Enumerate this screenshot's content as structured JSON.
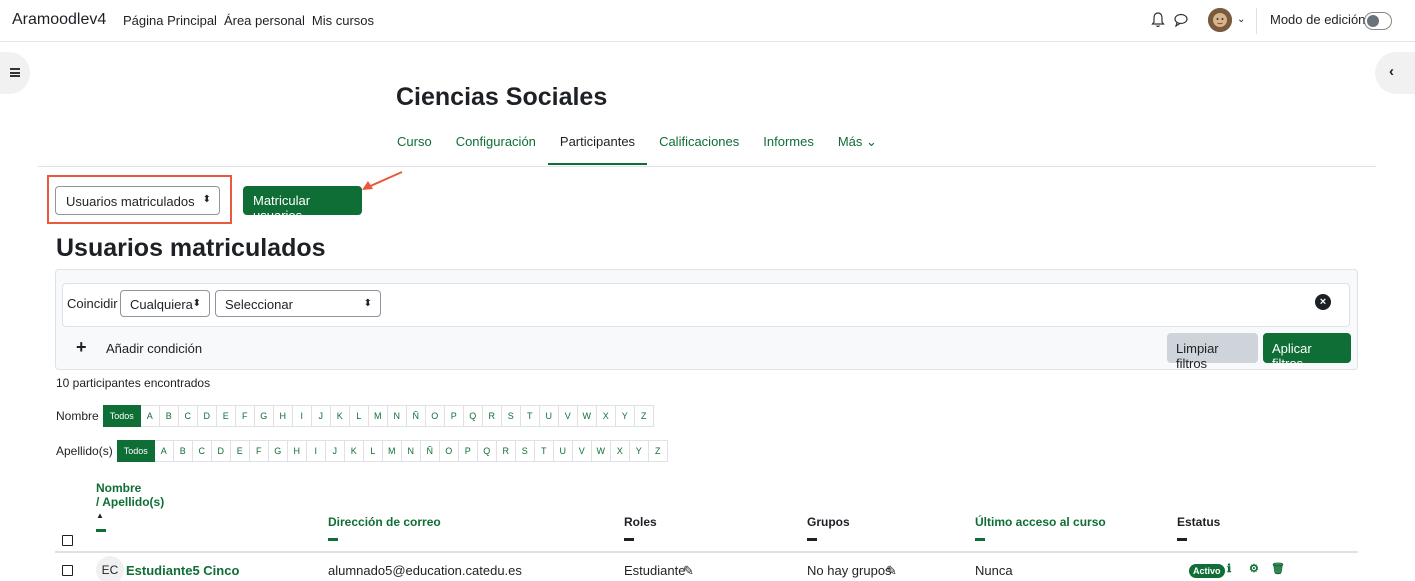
{
  "navbar": {
    "brand": "Aramoodlev4",
    "links": [
      "Página Principal",
      "Área personal",
      "Mis cursos"
    ],
    "edit_mode_label": "Modo de edición"
  },
  "course": {
    "title": "Ciencias Sociales",
    "tabs": [
      {
        "label": "Curso",
        "active": false
      },
      {
        "label": "Configuración",
        "active": false
      },
      {
        "label": "Participantes",
        "active": true
      },
      {
        "label": "Calificaciones",
        "active": false
      },
      {
        "label": "Informes",
        "active": false
      },
      {
        "label": "Más ⌄",
        "active": false
      }
    ]
  },
  "actions": {
    "view_select": "Usuarios matriculados",
    "enrol_button": "Matricular usuarios"
  },
  "section_title": "Usuarios matriculados",
  "filters": {
    "match_label": "Coincidir",
    "match_select": "Cualquiera",
    "condition_select": "Seleccionar",
    "add_condition": "Añadir condición",
    "clear_button": "Limpiar filtros",
    "apply_button": "Aplicar filtros"
  },
  "found_text": "10 participantes encontrados",
  "initials": {
    "first_label": "Nombre",
    "last_label": "Apellido(s)",
    "all_label": "Todos",
    "letters": [
      "A",
      "B",
      "C",
      "D",
      "E",
      "F",
      "G",
      "H",
      "I",
      "J",
      "K",
      "L",
      "M",
      "N",
      "Ñ",
      "O",
      "P",
      "Q",
      "R",
      "S",
      "T",
      "U",
      "V",
      "W",
      "X",
      "Y",
      "Z"
    ]
  },
  "table": {
    "headers": {
      "name_line1": "Nombre",
      "name_line2": "/ Apellido(s)",
      "email": "Dirección de correo",
      "roles": "Roles",
      "groups": "Grupos",
      "last_access": "Último acceso al curso",
      "status": "Estatus"
    },
    "rows": [
      {
        "initials": "EC",
        "name": "Estudiante5 Cinco",
        "email": "alumnado5@education.catedu.es",
        "role": "Estudiante",
        "groups": "No hay grupos",
        "last_access": "Nunca",
        "status": "Activo"
      }
    ]
  },
  "colors": {
    "brand_green": "#0f6e36",
    "highlight": "#e8593d"
  }
}
